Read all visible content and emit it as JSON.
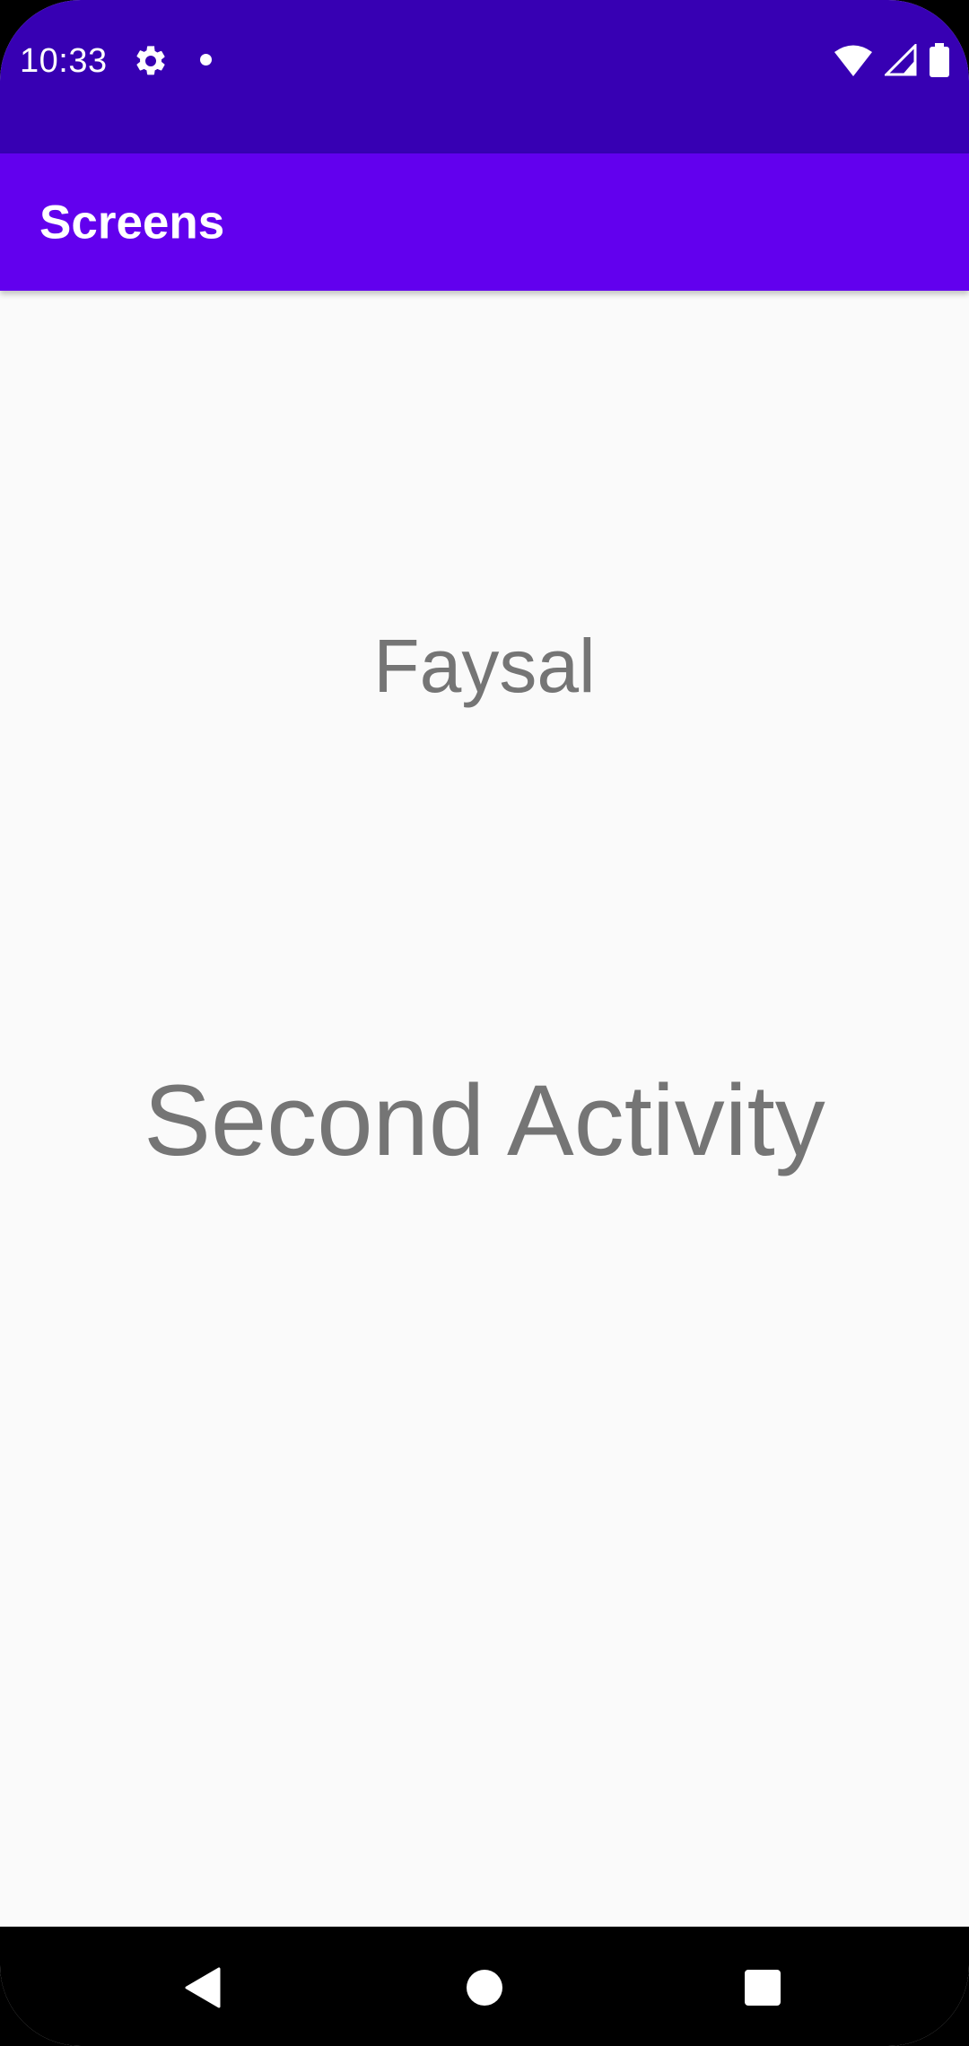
{
  "status_bar": {
    "time": "10:33",
    "icons": [
      "settings-gear-icon",
      "notification-dot-icon",
      "wifi-icon",
      "cell-signal-icon",
      "battery-icon"
    ],
    "background": "#3700B3"
  },
  "app_bar": {
    "title": "Screens",
    "background": "#6200EE"
  },
  "content": {
    "name_label": "Faysal",
    "activity_label": "Second Activity",
    "text_color": "#757575",
    "background": "#FAFAFA"
  },
  "nav_bar": {
    "buttons": [
      "back-icon",
      "home-icon",
      "recents-icon"
    ]
  }
}
